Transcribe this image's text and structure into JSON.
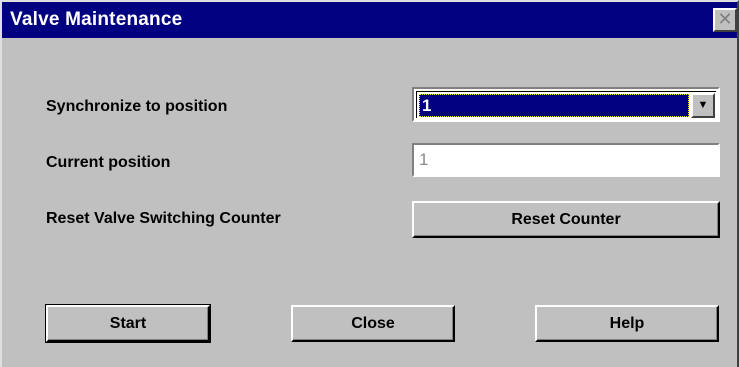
{
  "window": {
    "title": "Valve Maintenance",
    "close_glyph": "✕"
  },
  "fields": {
    "sync_label": "Synchronize to position",
    "sync_value": "1",
    "current_label": "Current position",
    "current_value": "1",
    "reset_label": "Reset Valve Switching Counter"
  },
  "buttons": {
    "reset_counter": "Reset Counter",
    "start": "Start",
    "close": "Close",
    "help": "Help"
  },
  "colors": {
    "face": "#c0c0c0",
    "title_bg": "#000080",
    "selection_bg": "#000080",
    "disabled_text": "#8a8a8a"
  },
  "icons": {
    "dropdown": "chevron-down-icon",
    "close": "close-icon"
  }
}
